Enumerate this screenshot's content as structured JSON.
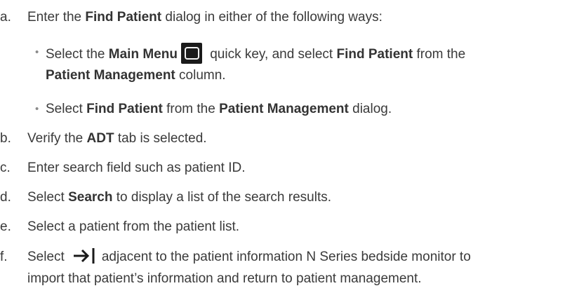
{
  "steps": {
    "a": {
      "marker": "a.",
      "t1": "Enter the ",
      "b1": "Find Patient",
      "t2": " dialog in either of the following ways:"
    },
    "a_bullet1": {
      "t1": "Select the ",
      "b1": "Main Menu",
      "t2": " quick key, and select ",
      "b2": "Find Patient",
      "t3": " from the",
      "line2_b1": "Patient Management",
      "line2_t1": " column."
    },
    "a_bullet2": {
      "t1": "Select ",
      "b1": "Find Patient",
      "t2": " from the ",
      "b2": "Patient Management",
      "t3": " dialog."
    },
    "b": {
      "marker": "b.",
      "t1": "Verify the ",
      "b1": "ADT",
      "t2": " tab is selected."
    },
    "c": {
      "marker": "c.",
      "t1": "Enter search field such as patient ID."
    },
    "d": {
      "marker": "d.",
      "t1": "Select ",
      "b1": "Search",
      "t2": " to display a list of the search results."
    },
    "e": {
      "marker": "e.",
      "t1": "Select a patient from the patient list."
    },
    "f": {
      "marker": "f.",
      "t1": "Select",
      "t2": "adjacent to the patient information N Series bedside monitor to",
      "line2": "import that patient’s information and return to patient management."
    }
  },
  "bullet_char": "•",
  "icons": {
    "main_menu": "main-menu-icon",
    "import": "import-arrow-icon"
  },
  "colors": {
    "text": "#3a3a3a",
    "icon_bg": "#1a1a1a"
  }
}
